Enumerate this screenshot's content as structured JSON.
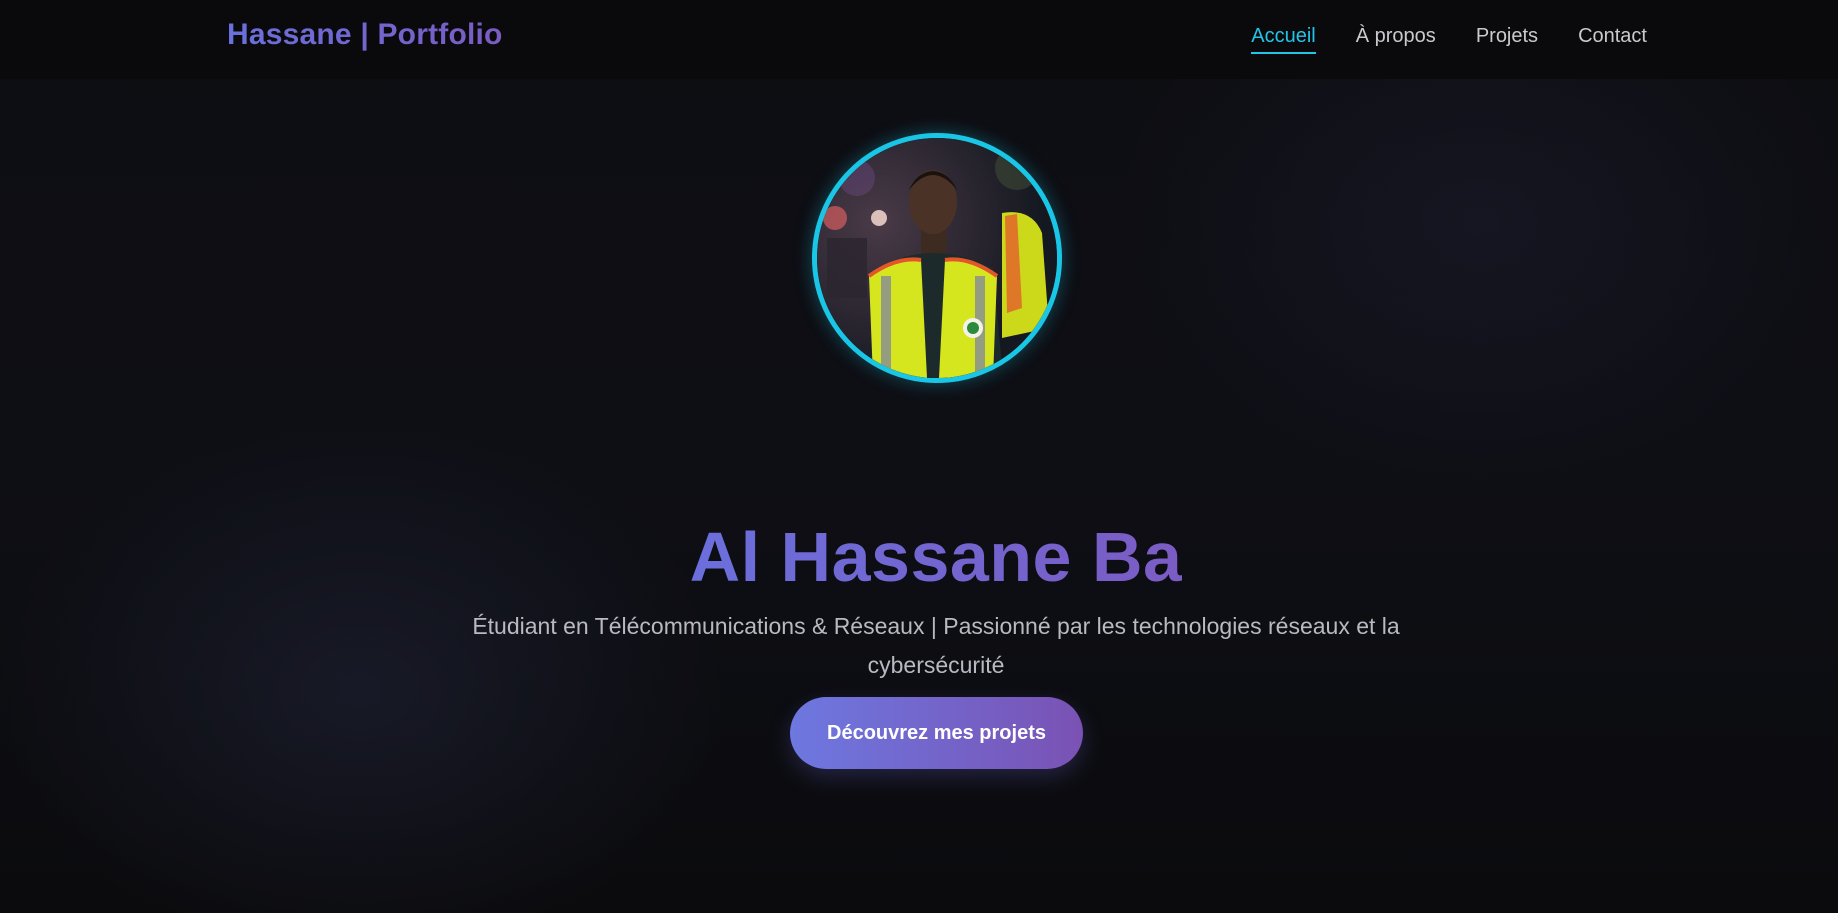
{
  "navbar": {
    "brand": "Hassane | Portfolio",
    "links": [
      {
        "label": "Accueil",
        "active": true
      },
      {
        "label": "À propos",
        "active": false
      },
      {
        "label": "Projets",
        "active": false
      },
      {
        "label": "Contact",
        "active": false
      }
    ]
  },
  "hero": {
    "avatar_icon": "profile-photo",
    "title": "Al Hassane Ba",
    "subtitle": "Étudiant en Télécommunications & Réseaux | Passionné par les technologies réseaux et la cybersécurité",
    "cta_label": "Découvrez mes projets"
  },
  "colors": {
    "accent": "#22c4e8",
    "brand_gradient_start": "#6b6fdc",
    "brand_gradient_end": "#7b5cc4",
    "background": "#0d0d12"
  }
}
